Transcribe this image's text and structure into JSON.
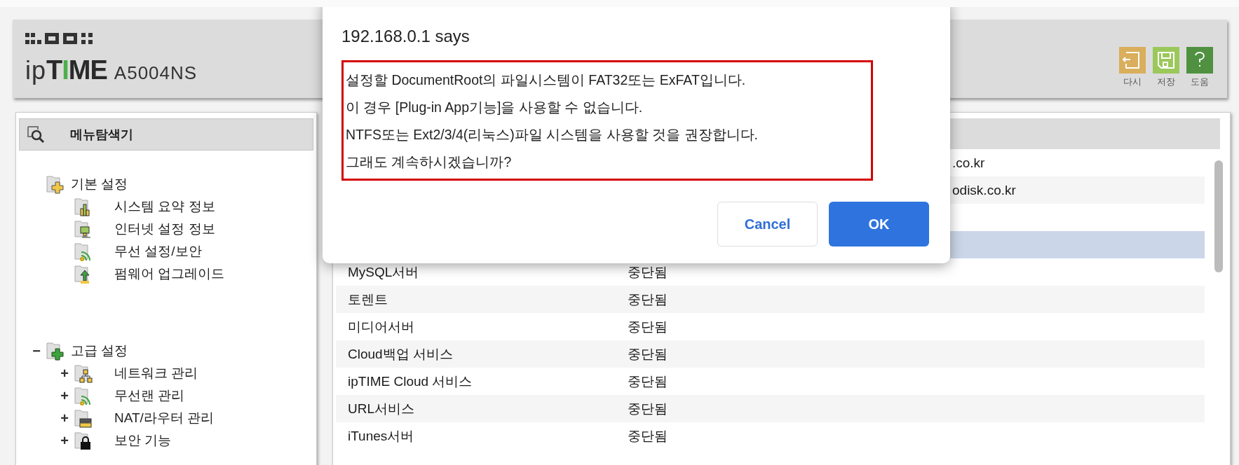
{
  "header": {
    "logo": {
      "prefix": "ip",
      "word": "TIME",
      "model": "A5004NS"
    },
    "tools": [
      {
        "kind": "reset",
        "label": "다시",
        "color": "#d9ae5c"
      },
      {
        "kind": "save",
        "label": "저장",
        "color": "#9bc85a"
      },
      {
        "kind": "help",
        "label": "도움",
        "color": "#4f9140"
      }
    ]
  },
  "sidebar": {
    "title": "메뉴탐색기",
    "groups": [
      {
        "label": "기본 설정",
        "kind": "basic",
        "children": [
          {
            "label": "시스템 요약 정보",
            "kind": "chart"
          },
          {
            "label": "인터넷 설정 정보",
            "kind": "monitor"
          },
          {
            "label": "무선 설정/보안",
            "kind": "wireless"
          },
          {
            "label": "펌웨어 업그레이드",
            "kind": "upgrade"
          }
        ]
      },
      {
        "label": "고급 설정",
        "kind": "advanced",
        "toggle": "−",
        "children": [
          {
            "label": "네트워크 관리",
            "kind": "network",
            "toggle": "+"
          },
          {
            "label": "무선랜 관리",
            "kind": "wireless",
            "toggle": "+"
          },
          {
            "label": "NAT/라우터 관리",
            "kind": "router",
            "toggle": "+"
          },
          {
            "label": "보안 기능",
            "kind": "lock",
            "toggle": "+"
          }
        ]
      }
    ]
  },
  "table": {
    "rows": [
      {
        "selected": false,
        "column_3": ".co.kr"
      },
      {
        "selected": false,
        "column_3": "odisk.co.kr"
      },
      {
        "selected": true
      },
      {
        "selected": false,
        "column_1": "MySQL서버",
        "column_2": "중단됨"
      },
      {
        "selected": false,
        "column_1": "토렌트",
        "column_2": "중단됨"
      },
      {
        "selected": false,
        "column_1": "미디어서버",
        "column_2": "중단됨"
      },
      {
        "selected": false,
        "column_1": "Cloud백업 서비스",
        "column_2": "중단됨"
      },
      {
        "selected": false,
        "column_1": "ipTIME Cloud 서비스",
        "column_2": "중단됨"
      },
      {
        "selected": false,
        "column_1": "URL서비스",
        "column_2": "중단됨"
      },
      {
        "selected": false,
        "column_1": "iTunes서버",
        "column_2": "중단됨"
      }
    ]
  },
  "dialog": {
    "title": "192.168.0.1 says",
    "message": [
      "설정할 DocumentRoot의 파일시스템이 FAT32또는 ExFAT입니다.",
      "이 경우 [Plug-in App기능]을 사용할 수 없습니다.",
      "NTFS또는 Ext2/3/4(리눅스)파일 시스템을 사용할 것을 권장합니다.",
      "그래도 계속하시겠습니까?"
    ],
    "buttons": [
      {
        "label": "Cancel",
        "kind": "secondary"
      },
      {
        "label": "OK",
        "kind": "primary"
      }
    ]
  }
}
